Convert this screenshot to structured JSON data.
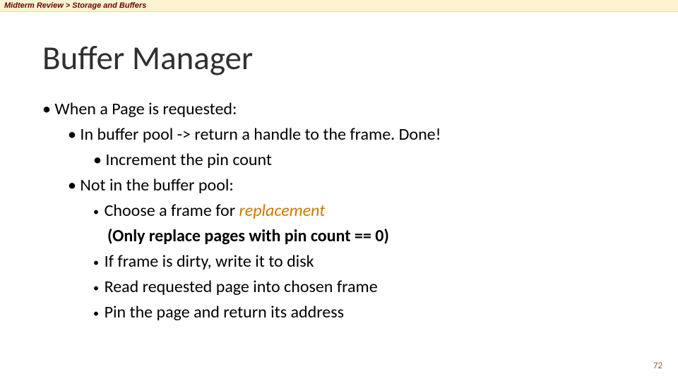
{
  "breadcrumb": {
    "parent": "Midterm Review",
    "sep": " > ",
    "child": "Storage and Buffers"
  },
  "title": "Buffer Manager",
  "bullets": {
    "b1": "When a Page is requested:",
    "b2": "In buffer pool -> return a handle to the frame. Done!",
    "b3": "Increment the pin count",
    "b4": "Not in the buffer pool:",
    "b5a": "Choose a frame for ",
    "b5b": "replacement",
    "b6": "(Only replace pages with pin count == 0)",
    "b7": "If frame is dirty, write it to disk",
    "b8": "Read requested page into chosen frame",
    "b9": "Pin the page and return its address"
  },
  "pageNumber": "72"
}
